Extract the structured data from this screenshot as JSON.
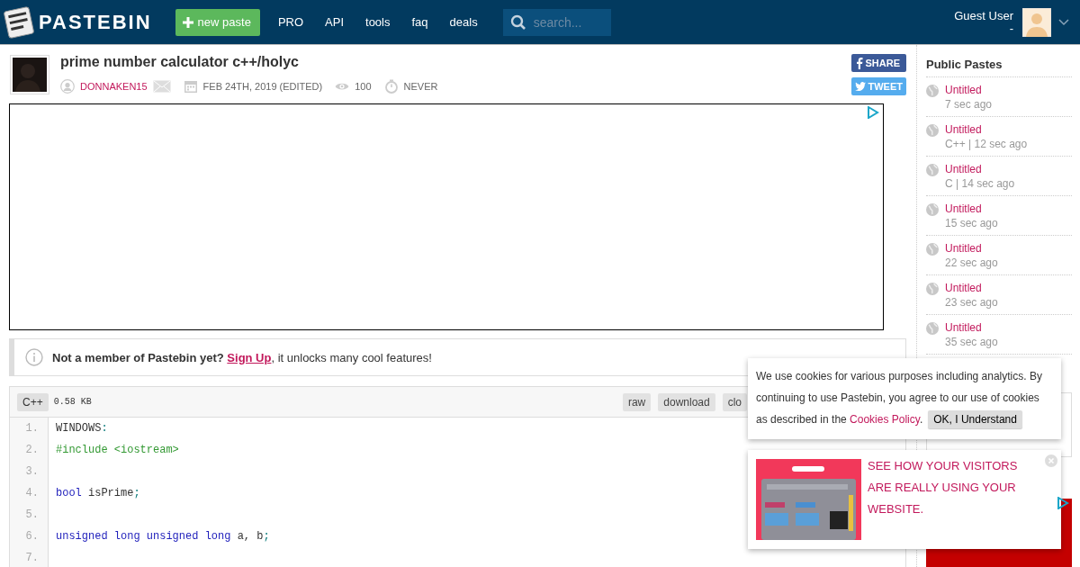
{
  "header": {
    "logo_text": "PASTEBIN",
    "new_paste": "new paste",
    "nav": [
      "PRO",
      "API",
      "tools",
      "faq",
      "deals"
    ],
    "search": {
      "placeholder": "search..."
    },
    "user": {
      "name": "Guest User",
      "sub": "-"
    }
  },
  "paste": {
    "title": "prime number calculator c++/holyc",
    "author": "DONNAKEN15",
    "date": "FEB 24TH, 2019 (EDITED)",
    "views": "100",
    "expires": "NEVER",
    "share": "SHARE",
    "tweet": "TWEET"
  },
  "notice": {
    "text": "**Not a member of Pastebin yet?**",
    "link": "Sign Up",
    "rest": ", it unlocks many cool features!"
  },
  "code": {
    "language": "C++",
    "size": "0.58 KB",
    "actions": [
      "raw",
      "download",
      "clo"
    ],
    "lines": [
      {
        "number": "1.",
        "tokens": [
          {
            "kind": "plain",
            "text": "WINDOWS"
          },
          {
            "kind": "punct",
            "text": ":"
          }
        ]
      },
      {
        "number": "2.",
        "tokens": [
          {
            "kind": "preprocessor",
            "text": "#include <iostream>"
          }
        ]
      },
      {
        "number": "3."
      },
      {
        "number": "4.",
        "tokens": [
          {
            "kind": "keyword",
            "text": "bool"
          },
          {
            "kind": "plain",
            "text": " isPrime"
          },
          {
            "kind": "punct",
            "text": ";"
          }
        ]
      },
      {
        "number": "5."
      },
      {
        "number": "6.",
        "tokens": [
          {
            "kind": "keyword",
            "text": "unsigned long unsigned long"
          },
          {
            "kind": "plain",
            "text": " a, b"
          },
          {
            "kind": "punct",
            "text": ";"
          }
        ]
      },
      {
        "number": "7."
      }
    ]
  },
  "sidebar": {
    "title": "Public Pastes",
    "items": [
      {
        "title": "Untitled",
        "meta": "7 sec ago"
      },
      {
        "title": "Untitled",
        "meta": "C++ | 12 sec ago"
      },
      {
        "title": "Untitled",
        "meta": "C | 14 sec ago"
      },
      {
        "title": "Untitled",
        "meta": "15 sec ago"
      },
      {
        "title": "Untitled",
        "meta": "22 sec ago"
      },
      {
        "title": "Untitled",
        "meta": "23 sec ago"
      },
      {
        "title": "Untitled",
        "meta": "35 sec ago"
      }
    ]
  },
  "cookie": {
    "text": "We use cookies for various purposes including analytics. By continuing to use Pastebin, you agree to our use of cookies",
    "text_2": "as described in the",
    "link": "Cookies Policy",
    "after": ".",
    "button": "OK, I Understand"
  },
  "ad_popup": {
    "text": "SEE HOW YOUR VISITORS ARE REALLY USING YOUR WEBSITE."
  }
}
